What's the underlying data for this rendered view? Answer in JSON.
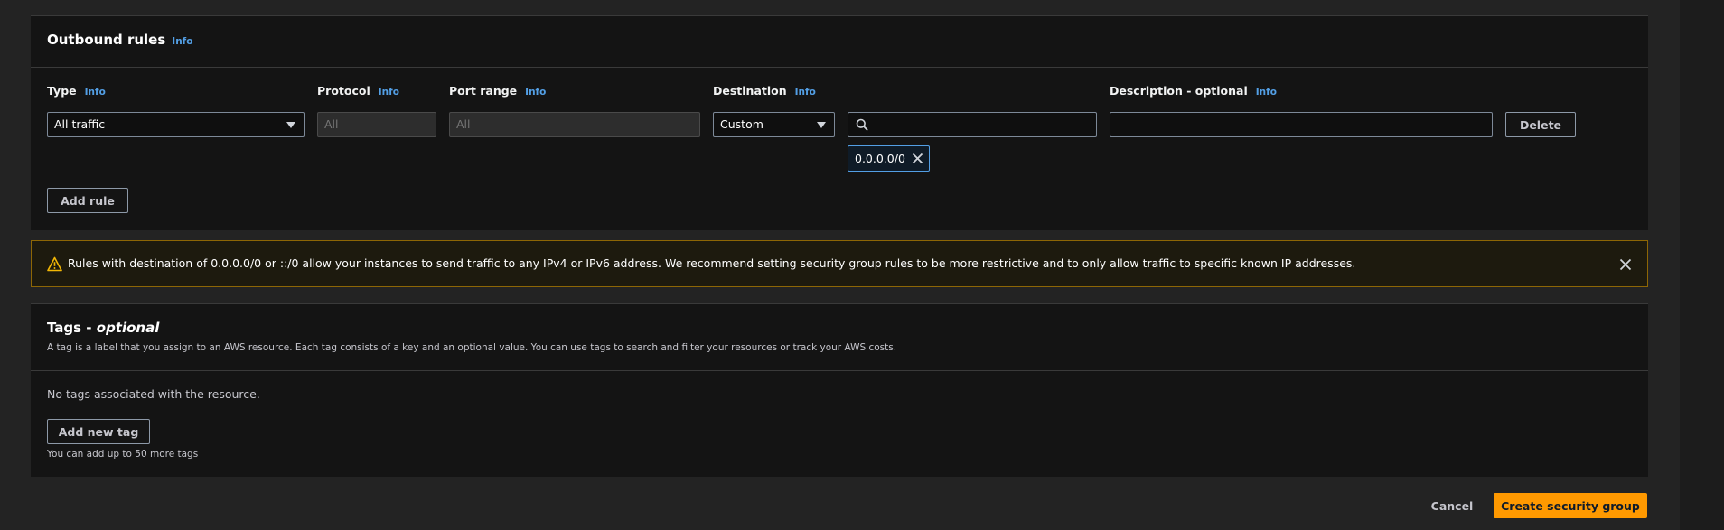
{
  "outbound": {
    "title": "Outbound rules",
    "info": "Info",
    "columns": {
      "type": "Type",
      "protocol": "Protocol",
      "port_range": "Port range",
      "destination": "Destination",
      "description": "Description - optional"
    },
    "rule": {
      "type_value": "All traffic",
      "protocol_value": "All",
      "port_value": "All",
      "destination_value": "Custom",
      "search_value": "",
      "description_value": "",
      "cidr_token": "0.0.0.0/0",
      "delete_label": "Delete"
    },
    "add_rule_label": "Add rule"
  },
  "warning": {
    "text": "Rules with destination of 0.0.0.0/0 or ::/0 allow your instances to send traffic to any IPv4 or IPv6 address. We recommend setting security group rules to be more restrictive and to only allow traffic to specific known IP addresses."
  },
  "tags": {
    "title": "Tags - ",
    "title_italic": "optional",
    "description": "A tag is a label that you assign to an AWS resource. Each tag consists of a key and an optional value. You can use tags to search and filter your resources or track your AWS costs.",
    "empty_text": "No tags associated with the resource.",
    "add_tag_label": "Add new tag",
    "hint": "You can add up to 50 more tags"
  },
  "footer": {
    "cancel_label": "Cancel",
    "create_label": "Create security group"
  },
  "colors": {
    "accent": "#539fe5",
    "primary": "#ff9900",
    "warning_border": "#8d6605",
    "warning_icon": "#f2b705"
  }
}
